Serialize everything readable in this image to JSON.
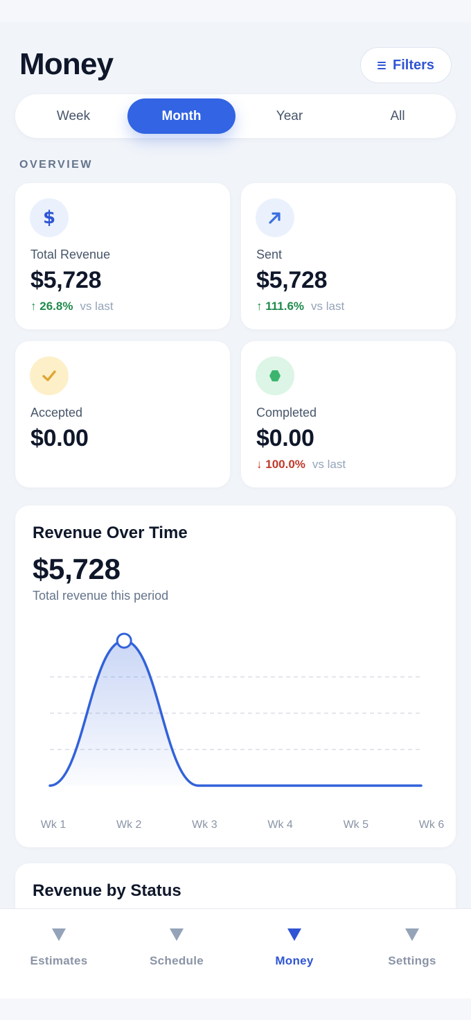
{
  "header": {
    "title": "Money",
    "filters_label": "Filters"
  },
  "period_tabs": [
    {
      "label": "Week",
      "active": false
    },
    {
      "label": "Month",
      "active": true
    },
    {
      "label": "Year",
      "active": false
    },
    {
      "label": "All",
      "active": false
    }
  ],
  "overview": {
    "section_label": "OVERVIEW",
    "cards": [
      {
        "icon": "dollar-icon",
        "label": "Total Revenue",
        "value": "$5,728",
        "delta_arrow": "↑",
        "delta_pct": "26.8%",
        "delta_vs": "vs last",
        "trend": "up",
        "icon_bg": "#eaf1fd",
        "icon_color": "#2f55d4"
      },
      {
        "icon": "arrow-up-right-icon",
        "label": "Sent",
        "value": "$5,728",
        "delta_arrow": "↑",
        "delta_pct": "111.6%",
        "delta_vs": "vs last",
        "trend": "up",
        "icon_bg": "#eaf1fd",
        "icon_color": "#3b6fe0"
      },
      {
        "icon": "checkmark-icon",
        "label": "Accepted",
        "value": "$0.00",
        "delta_arrow": "",
        "delta_pct": "",
        "delta_vs": "",
        "trend": "none",
        "icon_bg": "#fdf0c9",
        "icon_color": "#e0a634"
      },
      {
        "icon": "hexagon-icon",
        "label": "Completed",
        "value": "$0.00",
        "delta_arrow": "↓",
        "delta_pct": "100.0%",
        "delta_vs": "vs last",
        "trend": "down",
        "icon_bg": "#dcf5e6",
        "icon_color": "#3cb46e"
      }
    ]
  },
  "revenue_chart": {
    "title": "Revenue Over Time",
    "value": "$5,728",
    "subtitle": "Total revenue this period"
  },
  "chart_data": {
    "type": "area",
    "categories": [
      "Wk 1",
      "Wk 2",
      "Wk 3",
      "Wk 4",
      "Wk 5",
      "Wk 6"
    ],
    "values": [
      0,
      5728,
      0,
      0,
      0,
      0
    ],
    "title": "Revenue Over Time",
    "xlabel": "",
    "ylabel": "",
    "ylim": [
      0,
      5728
    ],
    "grid": true,
    "highlighted_point": 1,
    "color": "#3262da"
  },
  "status_section": {
    "title": "Revenue by Status"
  },
  "tabbar": [
    {
      "label": "Estimates",
      "active": false
    },
    {
      "label": "Schedule",
      "active": false
    },
    {
      "label": "Money",
      "active": true
    },
    {
      "label": "Settings",
      "active": false
    }
  ],
  "colors": {
    "accent": "#3264e3",
    "up": "#1f8a4c",
    "down": "#c0392b",
    "background": "#f1f4f9"
  }
}
